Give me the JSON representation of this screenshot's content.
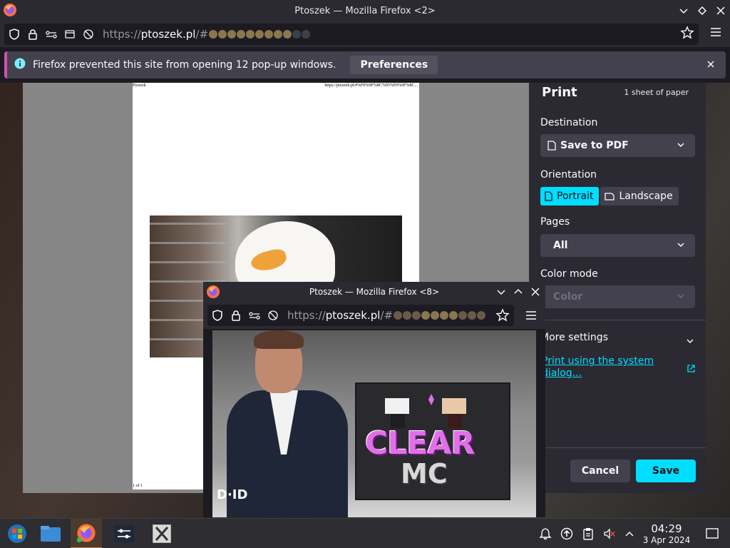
{
  "window": {
    "title": "Ptoszek — Mozilla Firefox <2>"
  },
  "navbar": {
    "url_prefix": "https://",
    "url_host": "ptoszek.pl",
    "url_rest": "/#"
  },
  "notification": {
    "message": "Firefox prevented this site from opening 12 pop-up windows.",
    "preferences_label": "Preferences"
  },
  "preview": {
    "header_left": "Ptoszek",
    "header_right": "https://ptoszek.pl/#%F0%9F%8C%95%F0%9F%8C...",
    "footer_left": "1 of 1"
  },
  "print": {
    "title": "Print",
    "sheets": "1 sheet of paper",
    "destination_label": "Destination",
    "destination_value": "Save to PDF",
    "orientation_label": "Orientation",
    "portrait": "Portrait",
    "landscape": "Landscape",
    "pages_label": "Pages",
    "pages_value": "All",
    "color_label": "Color mode",
    "color_value": "Color",
    "more_settings": "More settings",
    "system_dialog": "Print using the system dialog...",
    "cancel": "Cancel",
    "save": "Save",
    "accent": "#00ddff"
  },
  "popup": {
    "title": "Ptoszek — Mozilla Firefox <8>",
    "url_prefix": "https://",
    "url_host": "ptoszek.pl",
    "url_rest": "/#",
    "watermark": "D·ID",
    "banner_line1": "CLEAR",
    "banner_line2": "MC"
  },
  "taskbar": {
    "time": "04:29",
    "date": "3 Apr 2024"
  }
}
